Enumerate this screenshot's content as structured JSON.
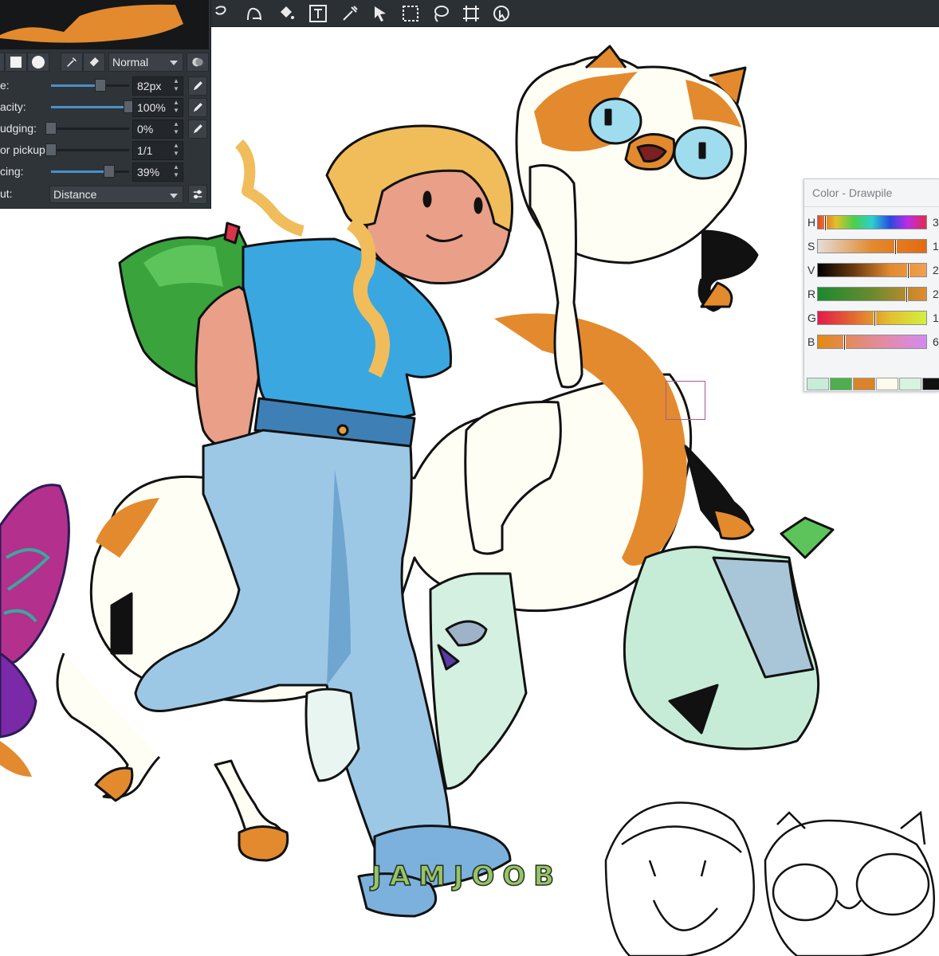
{
  "toolbar": {
    "tools": [
      {
        "name": "lasso-fill-tool",
        "icon": "lasso-icon"
      },
      {
        "name": "bezier-tool",
        "icon": "bezier-icon"
      },
      {
        "name": "fill-tool",
        "icon": "bucket-icon"
      },
      {
        "name": "text-tool",
        "icon": "text-icon"
      },
      {
        "name": "color-picker-tool",
        "icon": "eyedropper-icon"
      },
      {
        "name": "move-tool",
        "icon": "pointer-icon"
      },
      {
        "name": "rect-select-tool",
        "icon": "rect-select-icon"
      },
      {
        "name": "lasso-select-tool",
        "icon": "lasso-select-icon"
      },
      {
        "name": "transform-tool",
        "icon": "transform-icon"
      },
      {
        "name": "inspector-tool",
        "icon": "inspector-icon"
      }
    ]
  },
  "brush_panel": {
    "blend_mode": "Normal",
    "params": [
      {
        "label": "e:",
        "value": "82px",
        "level": 0.63
      },
      {
        "label": "acity:",
        "value": "100%",
        "level": 1.0
      },
      {
        "label": "udging:",
        "value": "0%",
        "level": 0.0
      },
      {
        "label": "or pickup:",
        "value": "1/1",
        "level": 0.0
      },
      {
        "label": "cing:",
        "value": "39%",
        "level": 0.74
      }
    ],
    "input_label": "ut:",
    "input_value": "Distance"
  },
  "color_panel": {
    "title": "Color - Drawpile",
    "channels": [
      {
        "label": "H",
        "value": "3"
      },
      {
        "label": "S",
        "value": "1"
      },
      {
        "label": "V",
        "value": "2"
      },
      {
        "label": "R",
        "value": "2"
      },
      {
        "label": "G",
        "value": "1"
      },
      {
        "label": "B",
        "value": "6"
      }
    ],
    "swatches": [
      "#c9ecd8",
      "#4fae4d",
      "#d9842a",
      "#fdfbe9",
      "#d8f3df",
      "#111111"
    ]
  },
  "watermark": "JAMJOOB",
  "colors": {
    "orange": "#e38a2e",
    "shirt_blue": "#3aa7e0",
    "jeans_blue": "#9cc8e6",
    "hair_yellow": "#f0bd5a",
    "skin": "#e99f88",
    "bag_green": "#3aa33c",
    "bag_mint": "#c6ecd8",
    "butterfly_magenta": "#c0308c"
  }
}
